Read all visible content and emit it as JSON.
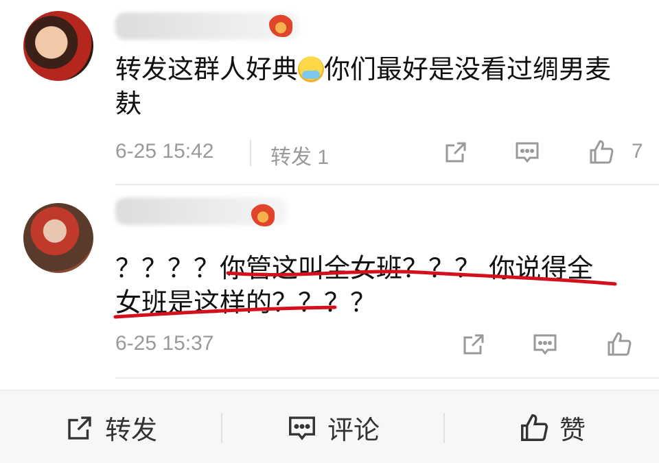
{
  "comments": [
    {
      "text_before_emoji": "转发这群人好典",
      "emoji": "mask-face-emoji",
      "text_after_emoji": "你们最好是没看过绸男麦麸",
      "time": "6-25 15:42",
      "repost_label": "转发 1",
      "like_count": "7"
    },
    {
      "text_line1": "？？？？你管这叫全女班？？？ 你说得全",
      "text_line2": "女班是这样的？？？？",
      "time": "6-25 15:37"
    }
  ],
  "bottom_bar": {
    "repost_label": "转发",
    "comment_label": "评论",
    "like_label": "赞"
  },
  "colors": {
    "meta_text": "#999999",
    "annotation_red": "#d4101c"
  },
  "icons": [
    "share-icon",
    "comment-icon",
    "like-icon",
    "fire-icon"
  ]
}
